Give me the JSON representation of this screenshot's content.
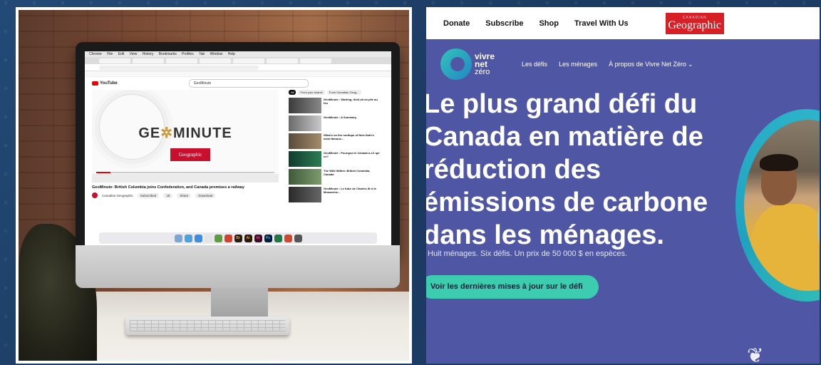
{
  "left_photo": {
    "screen": {
      "menubar": [
        "Chrome",
        "File",
        "Edit",
        "View",
        "History",
        "Bookmarks",
        "Profiles",
        "Tab",
        "Window",
        "Help"
      ],
      "search_query": "GeoMinute",
      "video": {
        "title_part1": "GE",
        "title_part2": "MINUTE",
        "badge_small": "CANADIAN",
        "badge": "Geographic",
        "caption": "GeoMinute: British Columbia joins Confederation, and Canada promises a railway",
        "channel": "Canadian Geographic",
        "subscribed": "Subscribed",
        "likes": "18",
        "share": "Share",
        "download": "Download"
      },
      "chips": [
        "All",
        "From your search",
        "From Canadian Geog..."
      ],
      "recommendations": [
        "GeoMinute : Starting, third all on pile au feu",
        "GeoMinute : A Summary",
        "What's on the rooftops of New Noth's most famous...",
        "GeoMinute : Pourquoi le Canada a-t-il qui ce?",
        "The Wild Within: British Columbia, Canada",
        "GeoMinute : Le futur de Charles III et le Monarchie..."
      ],
      "dock": [
        "Br",
        "Ai",
        "Id",
        "Ps"
      ]
    },
    "apple_logo": ""
  },
  "right_site": {
    "topnav": [
      "Donate",
      "Subscribe",
      "Shop",
      "Travel With Us"
    ],
    "logo_small": "CANADIAN",
    "logo": "Geographic",
    "brand": {
      "line1": "vivre",
      "line2": "net",
      "line3": "zéro"
    },
    "nav": [
      "Les défis",
      "Les ménages",
      "À propos de Vivre Net Zéro"
    ],
    "headline": "Le plus grand défi du Canada en matière de réduction des émissions de carbone dans les ménages.",
    "subline": "Huit ménages. Six défis. Un prix de 50 000 $ en espèces.",
    "cta": "Voir les dernières mises à jour sur le défi"
  },
  "colors": {
    "background": "#1e3f66",
    "site_purple": "#4f57a5",
    "cta": "#3ccdb0",
    "cg_red": "#d71f26"
  }
}
